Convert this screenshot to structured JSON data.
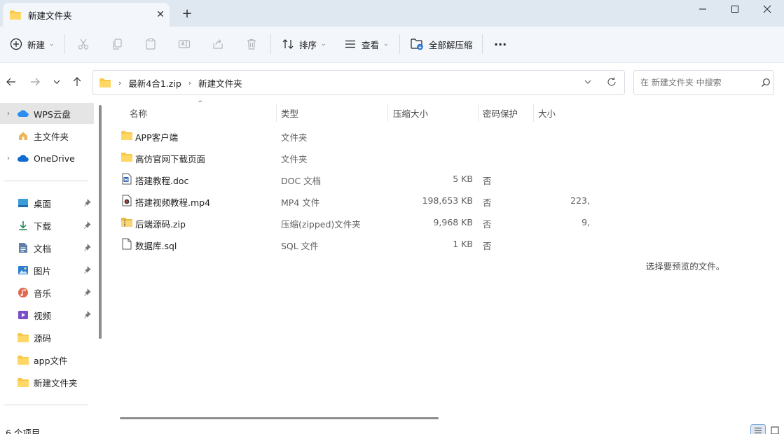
{
  "window": {
    "tab_title": "新建文件夹",
    "close_tab": "✕",
    "new_tab": "+"
  },
  "toolbar": {
    "new_label": "新建",
    "sort_label": "排序",
    "view_label": "查看",
    "extract_label": "全部解压缩",
    "more_label": "···"
  },
  "address": {
    "crumbs": [
      "最新4合1.zip",
      "新建文件夹"
    ],
    "separator": "›"
  },
  "search": {
    "placeholder": "在 新建文件夹 中搜索"
  },
  "nav": {
    "items": [
      {
        "label": "WPS云盘",
        "icon": "wps-cloud-icon",
        "expandable": true,
        "selected": true
      },
      {
        "label": "主文件夹",
        "icon": "home-icon",
        "expandable": false,
        "selected": false
      },
      {
        "label": "OneDrive",
        "icon": "onedrive-icon",
        "expandable": true,
        "selected": false
      }
    ],
    "quick": [
      {
        "label": "桌面",
        "icon": "desktop-icon",
        "pinned": true
      },
      {
        "label": "下载",
        "icon": "download-icon",
        "pinned": true
      },
      {
        "label": "文档",
        "icon": "documents-icon",
        "pinned": true
      },
      {
        "label": "图片",
        "icon": "pictures-icon",
        "pinned": true
      },
      {
        "label": "音乐",
        "icon": "music-icon",
        "pinned": true
      },
      {
        "label": "视频",
        "icon": "videos-icon",
        "pinned": true
      },
      {
        "label": "源码",
        "icon": "folder-icon",
        "pinned": false
      },
      {
        "label": "app文件",
        "icon": "folder-icon",
        "pinned": false
      },
      {
        "label": "新建文件夹",
        "icon": "folder-icon",
        "pinned": false
      }
    ]
  },
  "columns": {
    "name": "名称",
    "type": "类型",
    "compressed": "压缩大小",
    "password": "密码保护",
    "size": "大小"
  },
  "files": [
    {
      "name": "APP客户端",
      "type": "文件夹",
      "compressed": "",
      "password": "",
      "size": "",
      "icon": "folder-icon"
    },
    {
      "name": "高仿官网下载页面",
      "type": "文件夹",
      "compressed": "",
      "password": "",
      "size": "",
      "icon": "folder-icon"
    },
    {
      "name": "搭建教程.doc",
      "type": "DOC 文档",
      "compressed": "5 KB",
      "password": "否",
      "size": "",
      "icon": "word-doc-icon"
    },
    {
      "name": "搭建视频教程.mp4",
      "type": "MP4 文件",
      "compressed": "198,653 KB",
      "password": "否",
      "size": "223,",
      "icon": "video-file-icon"
    },
    {
      "name": "后端源码.zip",
      "type": "压缩(zipped)文件夹",
      "compressed": "9,968 KB",
      "password": "否",
      "size": "9,",
      "icon": "zip-folder-icon"
    },
    {
      "name": "数据库.sql",
      "type": "SQL 文件",
      "compressed": "1 KB",
      "password": "否",
      "size": "",
      "icon": "blank-file-icon"
    }
  ],
  "preview": {
    "message": "选择要预览的文件。"
  },
  "status": {
    "count": "6 个项目"
  },
  "colors": {
    "accent": "#0067c0",
    "folder": "#f8c945",
    "tabstrip": "#dfe7f1",
    "toolbar": "#f3f6fa"
  }
}
